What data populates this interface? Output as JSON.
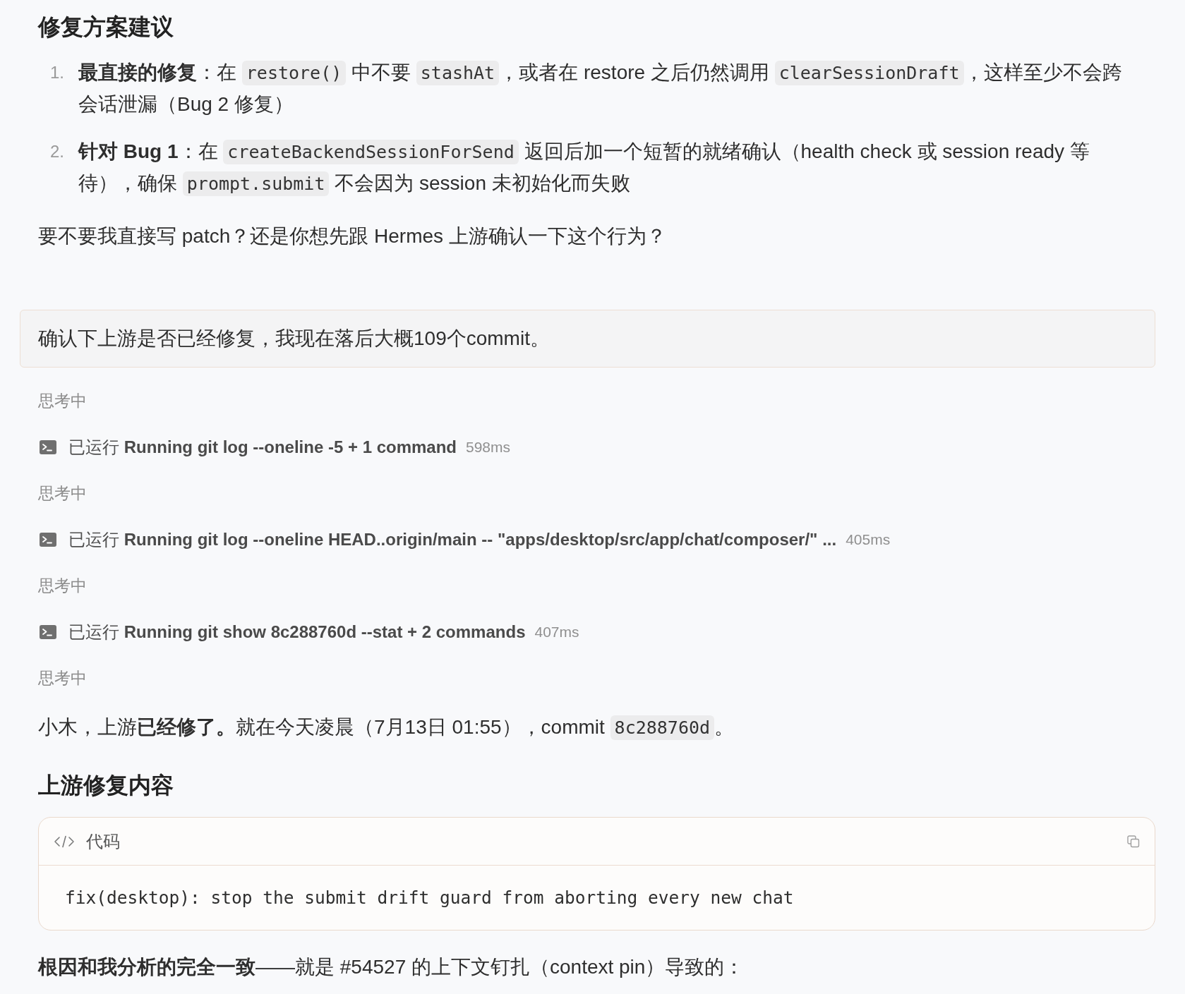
{
  "blocks": [
    {
      "kind": "heading",
      "text": "修复方案建议"
    },
    {
      "kind": "ordered_list",
      "items": [
        {
          "number": "1.",
          "parts": [
            {
              "kind": "text",
              "text": "**最直接的修复**：在 "
            },
            {
              "kind": "code",
              "text": "restore()"
            },
            {
              "kind": "text",
              "text": " 中不要 "
            },
            {
              "kind": "code",
              "text": "stashAt"
            },
            {
              "kind": "text",
              "text": "，或者在 restore 之后仍然调用 "
            },
            {
              "kind": "code",
              "text": "clearSessionDraft"
            },
            {
              "kind": "text",
              "text": "，这样至少不会跨会话泄漏（Bug 2 修复）"
            }
          ]
        },
        {
          "number": "2.",
          "parts": [
            {
              "kind": "text",
              "text": "**针对 Bug 1**：在 "
            },
            {
              "kind": "code",
              "text": "createBackendSessionForSend"
            },
            {
              "kind": "text",
              "text": " 返回后加一个短暂的就绪确认（health check 或 session ready 等待），确保 "
            },
            {
              "kind": "code",
              "text": "prompt.submit"
            },
            {
              "kind": "text",
              "text": " 不会因为 session 未初始化而失败"
            }
          ]
        }
      ]
    },
    {
      "kind": "paragraph",
      "parts": [
        {
          "kind": "text",
          "text": "要不要我直接写 patch？还是你想先跟 Hermes 上游确认一下这个行为？"
        }
      ]
    },
    {
      "kind": "user_message",
      "text": "确认下上游是否已经修复，我现在落后大概109个commit。"
    },
    {
      "kind": "thinking",
      "text": "思考中"
    },
    {
      "kind": "tool_call",
      "status": "已运行",
      "command": "Running git log --oneline -5 + 1 command",
      "duration": "598ms"
    },
    {
      "kind": "thinking",
      "text": "思考中"
    },
    {
      "kind": "tool_call",
      "status": "已运行",
      "command": "Running git log --oneline HEAD..origin/main -- \"apps/desktop/src/app/chat/composer/\" ...",
      "duration": "405ms"
    },
    {
      "kind": "thinking",
      "text": "思考中"
    },
    {
      "kind": "tool_call",
      "status": "已运行",
      "command": "Running git show 8c288760d --stat + 2 commands",
      "duration": "407ms"
    },
    {
      "kind": "thinking",
      "text": "思考中"
    },
    {
      "kind": "paragraph",
      "parts": [
        {
          "kind": "text",
          "text": "小木，上游**已经修了。**就在今天凌晨（7月13日 01:55），commit "
        },
        {
          "kind": "code",
          "text": "8c288760d"
        },
        {
          "kind": "text",
          "text": "。"
        }
      ]
    },
    {
      "kind": "heading",
      "text": "上游修复内容"
    },
    {
      "kind": "code_block",
      "label": "代码",
      "code": "fix(desktop): stop the submit drift guard from aborting every new chat"
    },
    {
      "kind": "paragraph",
      "parts": [
        {
          "kind": "text",
          "text": "**根因和我分析的完全一致**——就是 #54527 的上下文钉扎（context pin）导致的："
        }
      ]
    }
  ]
}
